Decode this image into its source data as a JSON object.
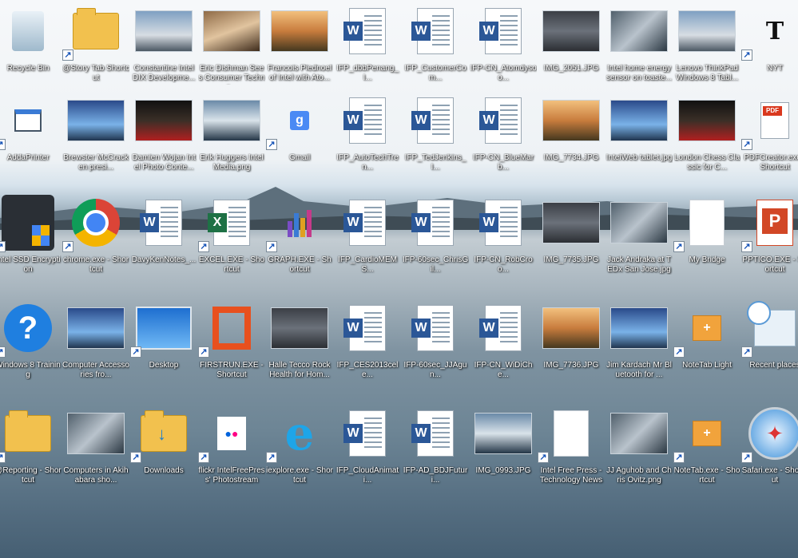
{
  "desktop": {
    "icons": [
      {
        "label": "Recycle Bin",
        "icon": "recycle-bin-icon",
        "shortcut": false
      },
      {
        "label": "@Story Tab Shortcut",
        "icon": "folder-icon",
        "shortcut": true
      },
      {
        "label": "Constantine Intel DIX Developme...",
        "icon": "photo-thumbnail",
        "shortcut": false
      },
      {
        "label": "Eric Dishman Sees Consumer Techno...",
        "icon": "photo-thumbnail",
        "shortcut": false
      },
      {
        "label": "Francois Piednoel of Intel with Ato...",
        "icon": "photo-thumbnail",
        "shortcut": false
      },
      {
        "label": "IFP_dbbPenang_I...",
        "icon": "word-document-icon",
        "shortcut": false
      },
      {
        "label": "IFP_CustomerCom...",
        "icon": "word-document-icon",
        "shortcut": false
      },
      {
        "label": "IFP-CN_Atomdysoo...",
        "icon": "word-document-icon",
        "shortcut": false
      },
      {
        "label": "IMG_2051.JPG",
        "icon": "photo-thumbnail",
        "shortcut": false
      },
      {
        "label": "Intel home energy sensor on toaste...",
        "icon": "photo-thumbnail",
        "shortcut": false
      },
      {
        "label": "Lenovo ThinkPad Windows 8 Tabl...",
        "icon": "photo-thumbnail",
        "shortcut": false
      },
      {
        "label": "NYT",
        "icon": "nyt-icon",
        "shortcut": true
      },
      {
        "label": "AddaPrinter",
        "icon": "printer-icon",
        "shortcut": true
      },
      {
        "label": "Brewster McCracken presi...",
        "icon": "photo-thumbnail",
        "shortcut": false
      },
      {
        "label": "Damien Wojan Intel Photo Conte...",
        "icon": "photo-thumbnail",
        "shortcut": false
      },
      {
        "label": "Erik Huggers Intel Media.png",
        "icon": "photo-thumbnail",
        "shortcut": false
      },
      {
        "label": "Gmail",
        "icon": "google-icon",
        "shortcut": true
      },
      {
        "label": "IFP_AutoTechTren...",
        "icon": "word-document-icon",
        "shortcut": false
      },
      {
        "label": "IFP_TedJenkins_I...",
        "icon": "word-document-icon",
        "shortcut": false
      },
      {
        "label": "IFP-CN_BlueMarb...",
        "icon": "word-document-icon",
        "shortcut": false
      },
      {
        "label": "IMG_7734.JPG",
        "icon": "photo-thumbnail",
        "shortcut": false
      },
      {
        "label": "IntelWeb tablet.jpg",
        "icon": "photo-thumbnail",
        "shortcut": false
      },
      {
        "label": "London Chess Classic for C...",
        "icon": "photo-thumbnail",
        "shortcut": false
      },
      {
        "label": "PDFCreator.exe - Shortcut",
        "icon": "pdf-icon",
        "shortcut": true
      },
      {
        "label": "Intel SSD Encryption",
        "icon": "ssd-shield-icon",
        "shortcut": true
      },
      {
        "label": "chrome.exe - Shortcut",
        "icon": "chrome-icon",
        "shortcut": true
      },
      {
        "label": "DavyKenNotes_...",
        "icon": "word-document-icon",
        "shortcut": false
      },
      {
        "label": "EXCEL.EXE - Shortcut",
        "icon": "excel-icon",
        "shortcut": true
      },
      {
        "label": "GRAPH.EXE - Shortcut",
        "icon": "graph-icon",
        "shortcut": true
      },
      {
        "label": "IFP_CardioMEMS...",
        "icon": "word-document-icon",
        "shortcut": false
      },
      {
        "label": "IFP-60sec_ChrisGil...",
        "icon": "word-document-icon",
        "shortcut": false
      },
      {
        "label": "IFP-CN_RobCroo...",
        "icon": "word-document-icon",
        "shortcut": false
      },
      {
        "label": "IMG_7735.JPG",
        "icon": "photo-thumbnail",
        "shortcut": false
      },
      {
        "label": "Jack Andraka at TEDx San Jose.jpg",
        "icon": "photo-thumbnail",
        "shortcut": false
      },
      {
        "label": "My Bridge",
        "icon": "blank-document-icon",
        "shortcut": true
      },
      {
        "label": "PPTICO.EXE - Shortcut",
        "icon": "powerpoint-icon",
        "shortcut": true
      },
      {
        "label": "Windows 8 Training",
        "icon": "help-icon",
        "shortcut": true
      },
      {
        "label": "Computer Accessories fro...",
        "icon": "photo-thumbnail",
        "shortcut": false
      },
      {
        "label": "Desktop",
        "icon": "desktop-icon",
        "shortcut": true
      },
      {
        "label": "FIRSTRUN.EXE - Shortcut",
        "icon": "office-icon",
        "shortcut": true
      },
      {
        "label": "Halle Tecco Rock Health for Hom...",
        "icon": "photo-thumbnail",
        "shortcut": false
      },
      {
        "label": "IFP_CES2013cele...",
        "icon": "word-document-icon",
        "shortcut": false
      },
      {
        "label": "IFP-60sec_JJAgun...",
        "icon": "word-document-icon",
        "shortcut": false
      },
      {
        "label": "IFP-CN_WiDiChe...",
        "icon": "word-document-icon",
        "shortcut": false
      },
      {
        "label": "IMG_7736.JPG",
        "icon": "photo-thumbnail",
        "shortcut": false
      },
      {
        "label": "Jim Kardach Mr Bluetooth for ...",
        "icon": "photo-thumbnail",
        "shortcut": false
      },
      {
        "label": "NoteTab Light",
        "icon": "notetab-icon",
        "shortcut": true
      },
      {
        "label": "Recent places",
        "icon": "recent-places-icon",
        "shortcut": true
      },
      {
        "label": "@Reporting - Shortcut",
        "icon": "folder-icon",
        "shortcut": true
      },
      {
        "label": "Computers in Akihabara sho...",
        "icon": "photo-thumbnail",
        "shortcut": false
      },
      {
        "label": "Downloads",
        "icon": "downloads-folder-icon",
        "shortcut": true
      },
      {
        "label": "flickr IntelFreePress' Photostream",
        "icon": "flickr-icon",
        "shortcut": true
      },
      {
        "label": "iexplore.exe - Shortcut",
        "icon": "internet-explorer-icon",
        "shortcut": true
      },
      {
        "label": "IFP_CloudAnimati...",
        "icon": "word-document-icon",
        "shortcut": false
      },
      {
        "label": "IFP-AD_BDJFuturi...",
        "icon": "word-document-icon",
        "shortcut": false
      },
      {
        "label": "IMG_0993.JPG",
        "icon": "photo-thumbnail",
        "shortcut": false
      },
      {
        "label": "Intel Free Press - Technology News",
        "icon": "web-link-icon",
        "shortcut": true
      },
      {
        "label": "JJ Aguhob and Chris Ovitz.png",
        "icon": "photo-thumbnail",
        "shortcut": false
      },
      {
        "label": "NoteTab.exe - Shortcut",
        "icon": "notetab-icon",
        "shortcut": true
      },
      {
        "label": "Safari.exe - Shortcut",
        "icon": "safari-icon",
        "shortcut": true
      }
    ]
  },
  "colors": {
    "word": "#2b5797",
    "excel": "#1e7145",
    "powerpoint": "#d24726",
    "office": "#e8501e"
  }
}
